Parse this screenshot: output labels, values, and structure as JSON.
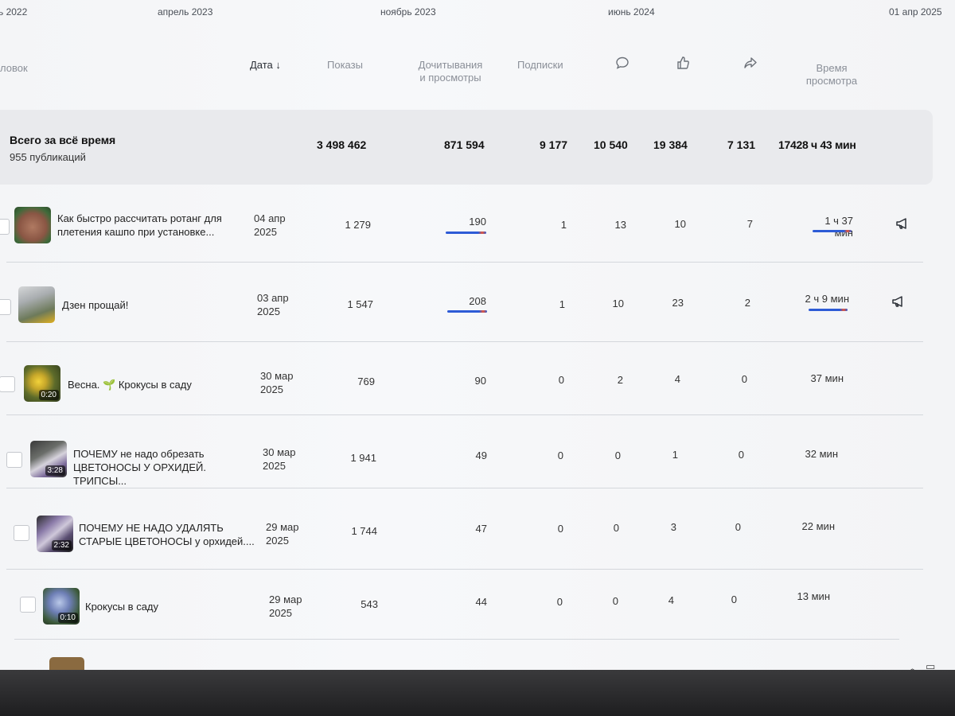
{
  "timeline": [
    "ь 2022",
    "апрель 2023",
    "ноябрь 2023",
    "июнь 2024",
    "01 апр 2025"
  ],
  "headers": {
    "title": "ловок",
    "date": "Дата",
    "impressions": "Показы",
    "reads": "Дочитывания\nи просмотры",
    "subscriptions": "Подписки",
    "watch_time": "Время\nпросмотра"
  },
  "totals": {
    "title": "Всего за всё время",
    "publications": "955 публикаций",
    "impressions": "3 498 462",
    "reads": "871 594",
    "subscriptions": "9 177",
    "comments": "10 540",
    "likes": "19 384",
    "shares": "7 131",
    "watch_time": "17428 ч 43 мин"
  },
  "rows": [
    {
      "title": "Как быстро рассчитать ротанг для плетения кашпо при установке...",
      "date": "04 апр\n2025",
      "impressions": "1 279",
      "reads": "190",
      "subscriptions": "1",
      "comments": "13",
      "likes": "10",
      "shares": "7",
      "watch_time": "1 ч 37 мин",
      "duration": "",
      "promo": true,
      "bar": 0.83
    },
    {
      "title": "Дзен прощай!",
      "date": "03 апр\n2025",
      "impressions": "1 547",
      "reads": "208",
      "subscriptions": "1",
      "comments": "10",
      "likes": "23",
      "shares": "2",
      "watch_time": "2 ч 9 мин",
      "duration": "",
      "promo": true,
      "bar": 0.83
    },
    {
      "title": "Весна. 🌱 Крокусы в саду",
      "date": "30 мар\n2025",
      "impressions": "769",
      "reads": "90",
      "subscriptions": "0",
      "comments": "2",
      "likes": "4",
      "shares": "0",
      "watch_time": "37 мин",
      "duration": "0:20",
      "promo": false,
      "bar": 0
    },
    {
      "title": "ПОЧЕМУ не надо обрезать ЦВЕТОНОСЫ У ОРХИДЕЙ. ТРИПСЫ...",
      "date": "30 мар\n2025",
      "impressions": "1 941",
      "reads": "49",
      "subscriptions": "0",
      "comments": "0",
      "likes": "1",
      "shares": "0",
      "watch_time": "32 мин",
      "duration": "3:28",
      "promo": false,
      "bar": 0
    },
    {
      "title": "ПОЧЕМУ НЕ НАДО УДАЛЯТЬ СТАРЫЕ ЦВЕТОНОСЫ у орхидей....",
      "date": "29 мар\n2025",
      "impressions": "1 744",
      "reads": "47",
      "subscriptions": "0",
      "comments": "0",
      "likes": "3",
      "shares": "0",
      "watch_time": "22 мин",
      "duration": "2:32",
      "promo": false,
      "bar": 0
    },
    {
      "title": "Крокусы в саду",
      "date": "29 мар\n2025",
      "impressions": "543",
      "reads": "44",
      "subscriptions": "0",
      "comments": "0",
      "likes": "4",
      "shares": "0",
      "watch_time": "13 мин",
      "duration": "0:10",
      "promo": false,
      "bar": 0
    }
  ],
  "colors": {
    "accent": "#2d5bd6",
    "bar_warm": "#e8573a",
    "total_bg": "#e9eaed"
  }
}
